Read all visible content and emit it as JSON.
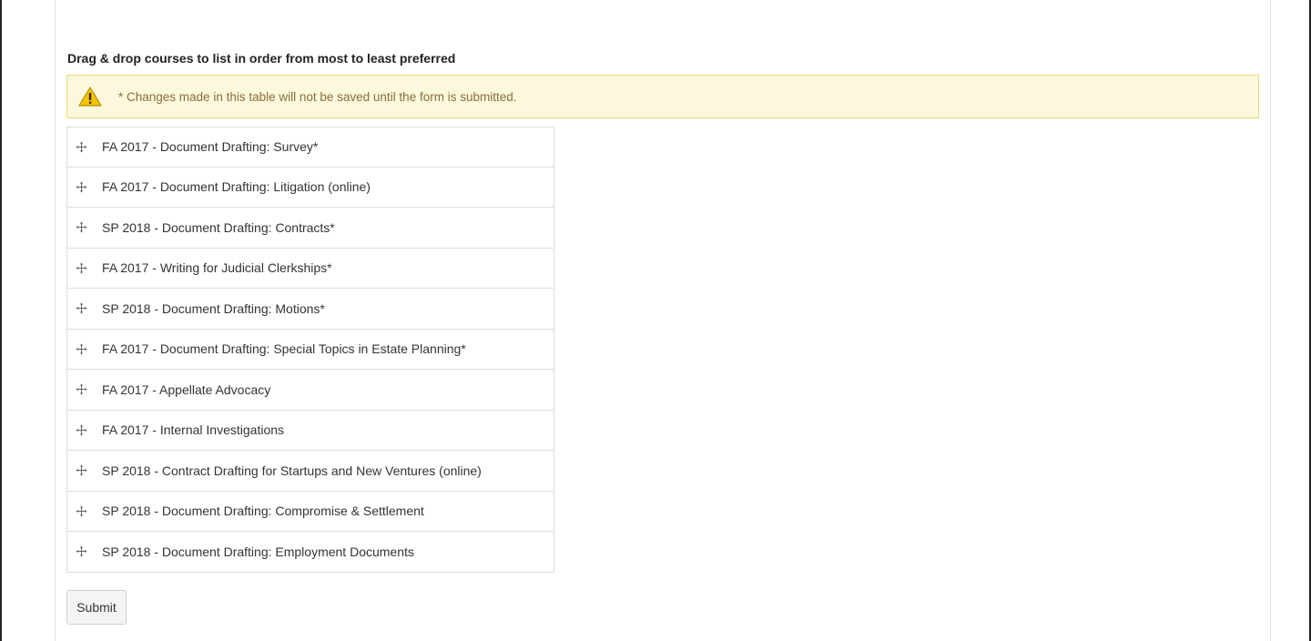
{
  "heading": "Drag & drop courses to list in order from most to least preferred",
  "alert": {
    "icon": "warning-icon",
    "text": "* Changes made in this table will not be saved until the form is submitted."
  },
  "courses": [
    "FA 2017 - Document Drafting: Survey*",
    "FA 2017 - Document Drafting: Litigation (online)",
    "SP 2018 - Document Drafting: Contracts*",
    "FA 2017 - Writing for Judicial Clerkships*",
    "SP 2018 - Document Drafting: Motions*",
    "FA 2017 - Document Drafting: Special Topics in Estate Planning*",
    "FA 2017 - Appellate Advocacy",
    "FA 2017 - Internal Investigations",
    "SP 2018 - Contract Drafting for Startups and New Ventures (online)",
    "SP 2018 - Document Drafting: Compromise & Settlement",
    "SP 2018 - Document Drafting: Employment Documents"
  ],
  "submit_label": "Submit",
  "colors": {
    "alert_bg": "#fcf8dc",
    "alert_border": "#e8dc7a",
    "alert_text": "#8a6d3b",
    "warning_yellow": "#f5c400"
  }
}
